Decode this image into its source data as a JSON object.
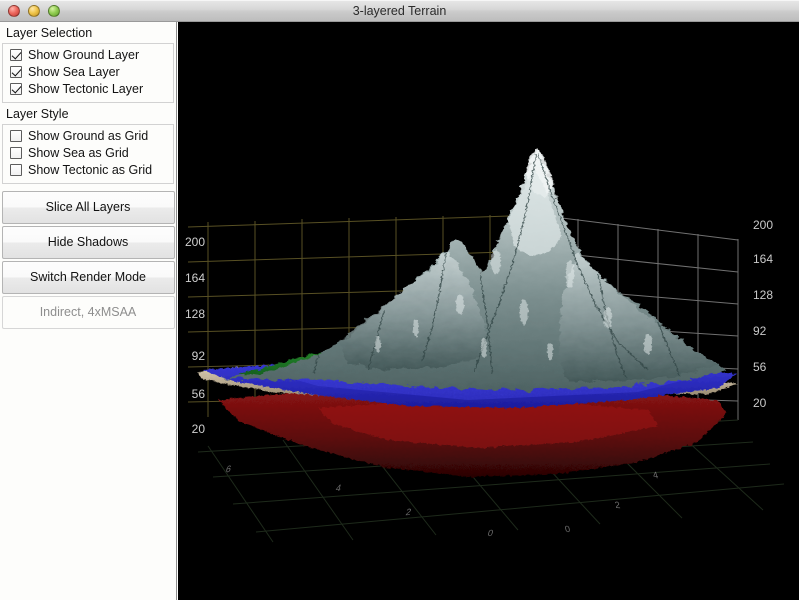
{
  "window": {
    "title": "3-layered Terrain",
    "controls": [
      {
        "name": "close-button",
        "color": "#ee6a60"
      },
      {
        "name": "minimize-button",
        "color": "#f0c64c"
      },
      {
        "name": "maximize-button",
        "color": "#93ce54"
      }
    ]
  },
  "sidebar": {
    "groups": [
      {
        "title": "Layer Selection",
        "checkboxes": [
          {
            "label": "Show Ground Layer",
            "checked": true
          },
          {
            "label": "Show Sea Layer",
            "checked": true
          },
          {
            "label": "Show Tectonic Layer",
            "checked": true
          }
        ]
      },
      {
        "title": "Layer Style",
        "checkboxes": [
          {
            "label": "Show Ground as Grid",
            "checked": false
          },
          {
            "label": "Show Sea as Grid",
            "checked": false
          },
          {
            "label": "Show Tectonic as Grid",
            "checked": false
          }
        ]
      }
    ],
    "buttons": [
      {
        "label": "Slice All Layers",
        "disabled": false
      },
      {
        "label": "Hide Shadows",
        "disabled": false
      },
      {
        "label": "Switch Render Mode",
        "disabled": false
      },
      {
        "label": "Indirect, 4xMSAA",
        "disabled": true
      }
    ]
  },
  "viewport": {
    "background": "#000000",
    "axis_left": {
      "labels": [
        "200",
        "164",
        "128",
        "92",
        "56",
        "20"
      ]
    },
    "axis_right": {
      "labels": [
        "200",
        "164",
        "128",
        "92",
        "56",
        "20"
      ]
    },
    "floor_labels": [
      "6",
      "4",
      "2",
      "0",
      "0",
      "2",
      "4"
    ],
    "layers": [
      {
        "name": "ground-layer",
        "color": "#9aa8a8",
        "label": "Ground"
      },
      {
        "name": "sea-layer",
        "color": "#2a2ac8",
        "label": "Sea"
      },
      {
        "name": "vegetation",
        "color": "#1f7a22",
        "label": "Vegetation"
      },
      {
        "name": "tectonic-layer",
        "color": "#7a0f0f",
        "label": "Tectonic"
      },
      {
        "name": "sand-rim",
        "color": "#cdbda2",
        "label": "Sand"
      }
    ],
    "grid_back_color": "#5a5326",
    "grid_right_color": "#9a9a9a",
    "grid_floor_color": "#24341f"
  }
}
